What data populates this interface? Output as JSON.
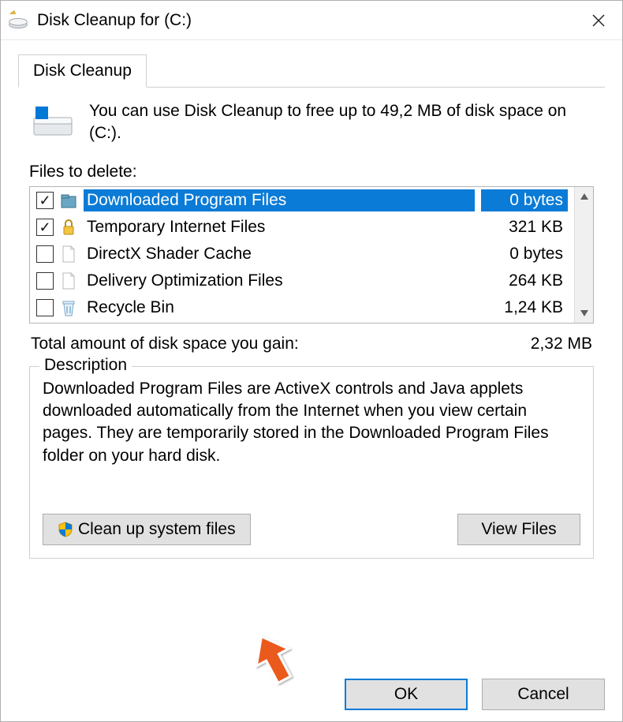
{
  "window": {
    "title": "Disk Cleanup for  (C:)"
  },
  "tab": {
    "label": "Disk Cleanup"
  },
  "intro": {
    "text": "You can use Disk Cleanup to free up to 49,2 MB of disk space on  (C:)."
  },
  "files": {
    "label": "Files to delete:",
    "rows": [
      {
        "checked": true,
        "icon": "folder",
        "name": "Downloaded Program Files",
        "size": "0 bytes",
        "selected": true
      },
      {
        "checked": true,
        "icon": "lock",
        "name": "Temporary Internet Files",
        "size": "321 KB",
        "selected": false
      },
      {
        "checked": false,
        "icon": "file",
        "name": "DirectX Shader Cache",
        "size": "0 bytes",
        "selected": false
      },
      {
        "checked": false,
        "icon": "file",
        "name": "Delivery Optimization Files",
        "size": "264 KB",
        "selected": false
      },
      {
        "checked": false,
        "icon": "recycle-bin",
        "name": "Recycle Bin",
        "size": "1,24 KB",
        "selected": false
      }
    ]
  },
  "total": {
    "label": "Total amount of disk space you gain:",
    "value": "2,32 MB"
  },
  "description": {
    "legend": "Description",
    "text": "Downloaded Program Files are ActiveX controls and Java applets downloaded automatically from the Internet when you view certain pages. They are temporarily stored in the Downloaded Program Files folder on your hard disk."
  },
  "buttons": {
    "cleanup": "Clean up system files",
    "view": "View Files",
    "ok": "OK",
    "cancel": "Cancel"
  }
}
